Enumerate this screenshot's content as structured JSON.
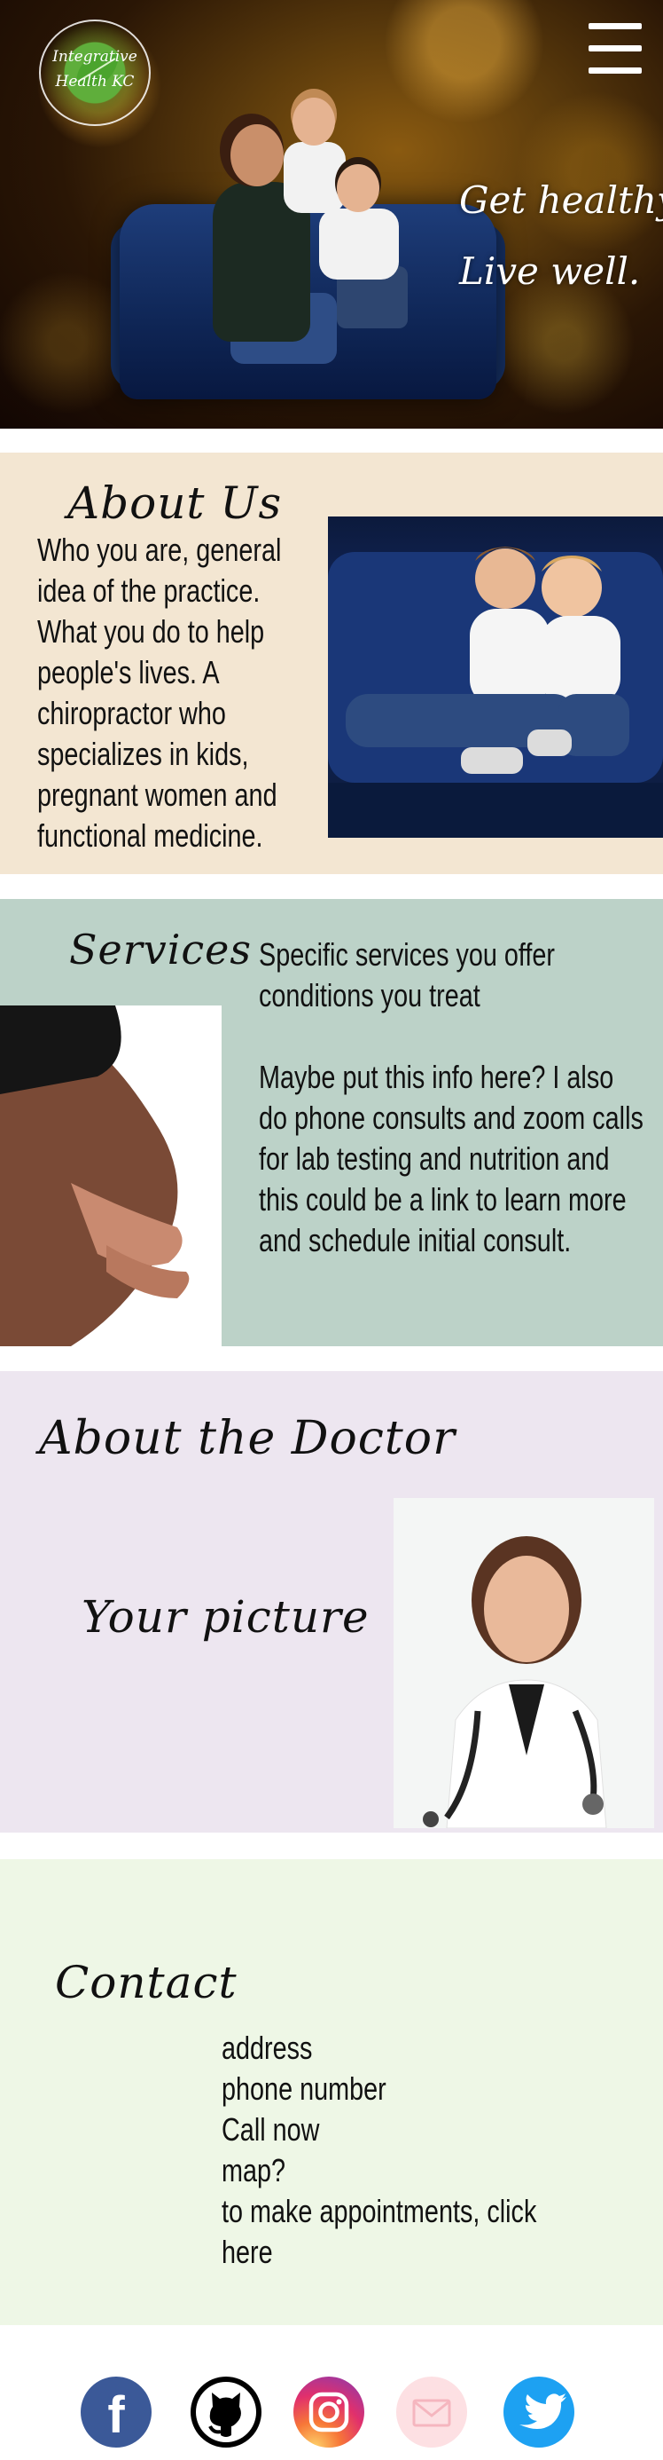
{
  "header": {
    "logo_line1": "Integrative",
    "logo_line2": "Health KC",
    "tagline_line1": "Get healthy,",
    "tagline_line2": "Live well."
  },
  "about": {
    "heading": "About Us",
    "lines": [
      "Who you are, general",
      "idea of the practice.",
      "What you do to help",
      "people's lives. A",
      "chiropractor who",
      "specializes in kids,",
      "pregnant women and",
      "functional medicine."
    ]
  },
  "services": {
    "heading": "Services",
    "lines_top": [
      "Specific services you offer",
      "conditions you treat"
    ],
    "lines_bottom": [
      "Maybe put this info here? I also",
      "do phone consults and zoom calls",
      "for lab testing and nutrition and",
      "this could be a link to learn more",
      "and schedule initial consult."
    ]
  },
  "doctor": {
    "heading": "About the Doctor",
    "placeholder": "Your picture"
  },
  "contact": {
    "heading": "Contact",
    "lines": [
      "address",
      "phone number",
      "Call now",
      "map?",
      "to make appointments, click here"
    ]
  },
  "social": {
    "icons": [
      "facebook-icon",
      "github-icon",
      "instagram-icon",
      "email-icon",
      "twitter-icon"
    ],
    "colors": {
      "facebook": "#3b5998",
      "github": "#000000",
      "instagram": "#c13584",
      "email": "#fde0e3",
      "twitter": "#1da1f2"
    }
  },
  "colors": {
    "about_bg": "#f3e6d2",
    "services_bg": "#bcd2c8",
    "doctor_bg": "#ede6f0",
    "contact_bg": "#eef7e6"
  }
}
